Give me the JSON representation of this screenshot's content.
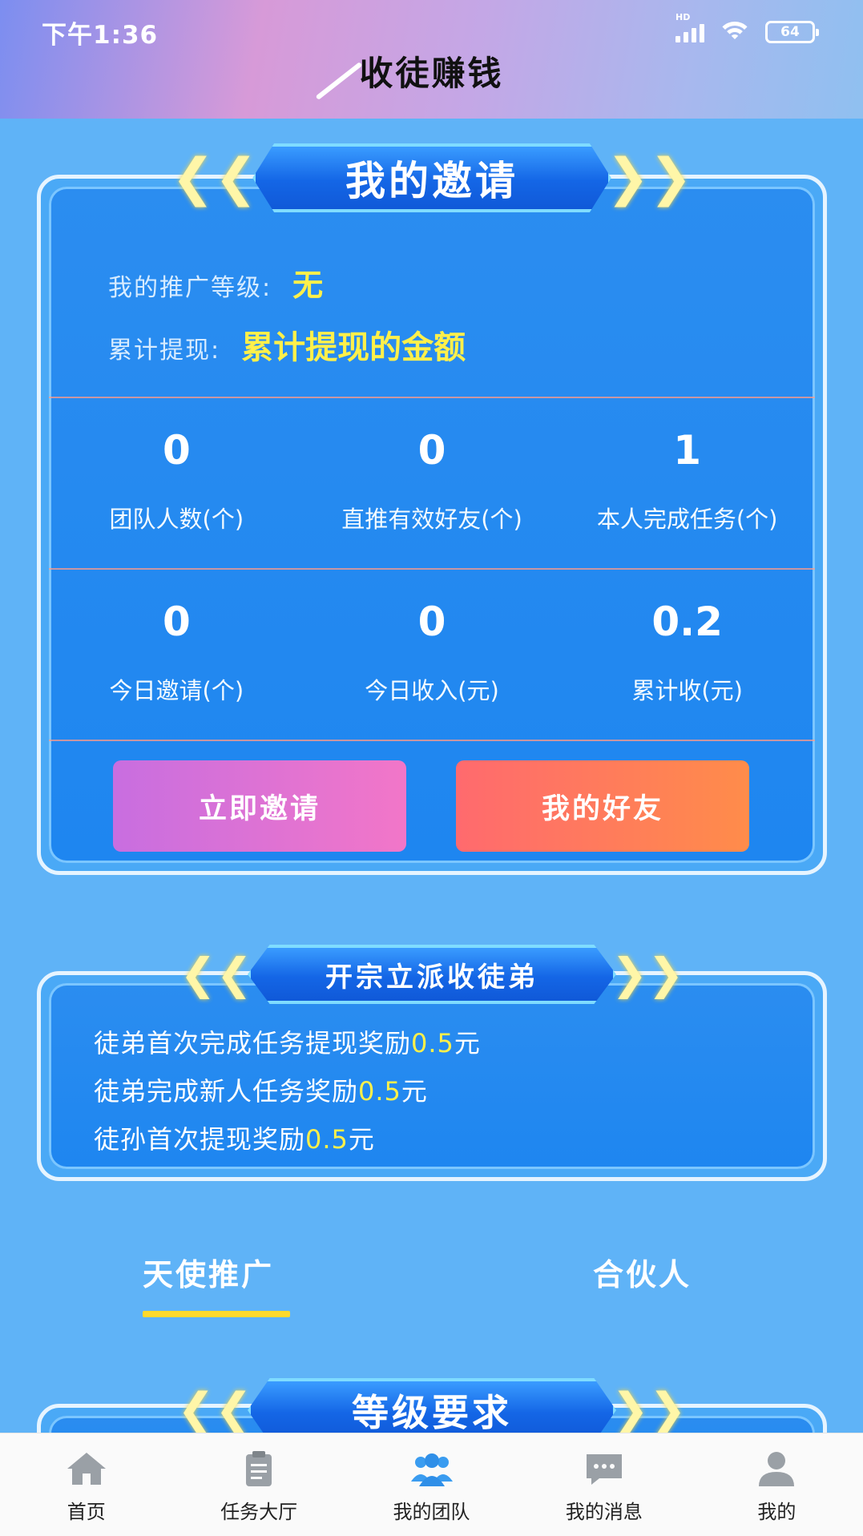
{
  "status_bar": {
    "time": "下午1:36",
    "signal_label": "HD",
    "battery": "64"
  },
  "header": {
    "title": "收徒赚钱"
  },
  "invite_card": {
    "banner": "我的邀请",
    "level_label": "我的推广等级:",
    "level_value": "无",
    "withdraw_label": "累计提现:",
    "withdraw_value": "累计提现的金额",
    "stats_row1": [
      {
        "value": "0",
        "label": "团队人数(个)"
      },
      {
        "value": "0",
        "label": "直推有效好友(个)"
      },
      {
        "value": "1",
        "label": "本人完成任务(个)"
      }
    ],
    "stats_row2": [
      {
        "value": "0",
        "label": "今日邀请(个)"
      },
      {
        "value": "0",
        "label": "今日收入(元)"
      },
      {
        "value": "0.2",
        "label": "累计收(元)"
      }
    ],
    "invite_button": "立即邀请",
    "friends_button": "我的好友"
  },
  "rewards_card": {
    "banner": "开宗立派收徒弟",
    "lines": [
      {
        "text": "徒弟首次完成任务提现奖励",
        "amount": "0.5",
        "unit": "元"
      },
      {
        "text": "徒弟完成新人任务奖励",
        "amount": "0.5",
        "unit": "元"
      },
      {
        "text": "徒孙首次提现奖励",
        "amount": "0.5",
        "unit": "元"
      }
    ]
  },
  "tabs": [
    {
      "label": "天使推广",
      "active": true
    },
    {
      "label": "合伙人",
      "active": false
    }
  ],
  "level_card": {
    "banner": "等级要求"
  },
  "bottom_nav": [
    {
      "label": "首页",
      "icon": "home-icon"
    },
    {
      "label": "任务大厅",
      "icon": "clipboard-icon"
    },
    {
      "label": "我的团队",
      "icon": "team-icon",
      "active": true
    },
    {
      "label": "我的消息",
      "icon": "message-icon"
    },
    {
      "label": "我的",
      "icon": "user-icon"
    }
  ],
  "colors": {
    "accent_yellow": "#fff04a",
    "active_nav": "#3a9cf0",
    "inactive_nav": "#9aa0a6"
  }
}
